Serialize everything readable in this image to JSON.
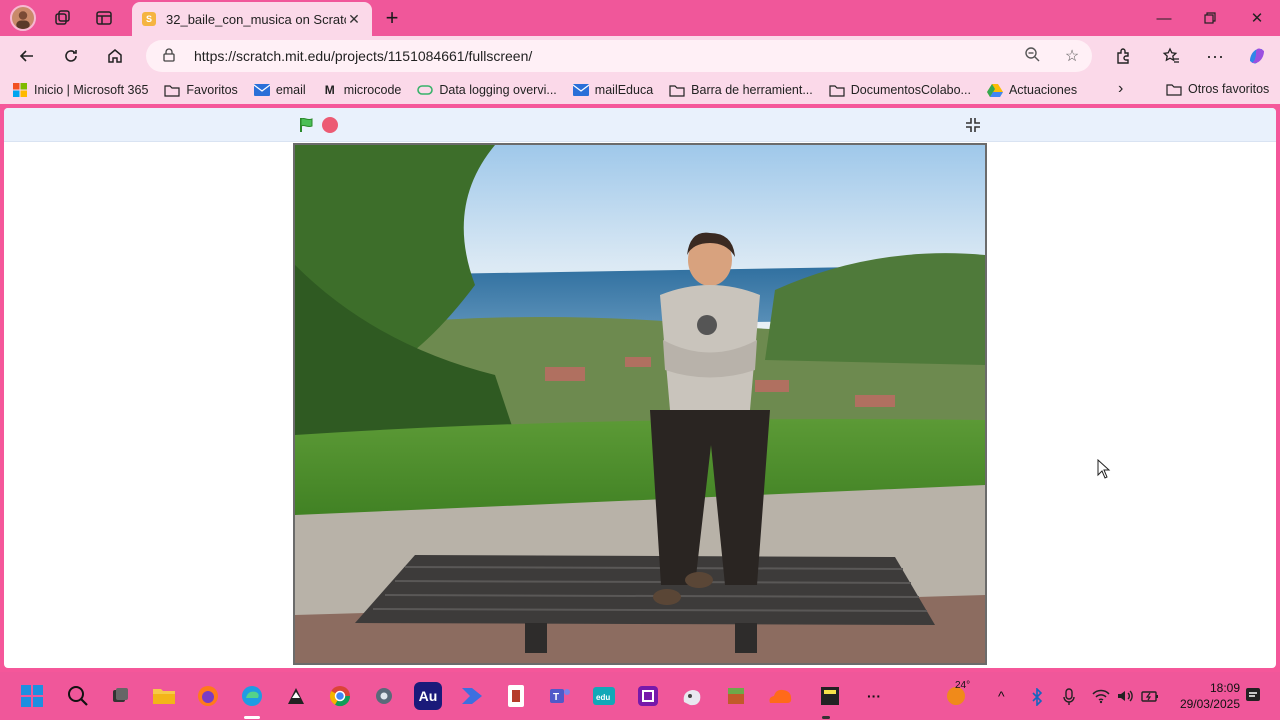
{
  "browser": {
    "tab": {
      "title": "32_baile_con_musica on Scratch",
      "favicon_icon": "scratch-icon"
    },
    "url": "https://scratch.mit.edu/projects/1151084661/fullscreen/",
    "accent_color": "#f0579a"
  },
  "bookmarks": {
    "items": [
      {
        "label": "Inicio | Microsoft 365",
        "icon": "microsoft-icon"
      },
      {
        "label": "Favoritos",
        "icon": "folder-icon"
      },
      {
        "label": "email",
        "icon": "mail-icon"
      },
      {
        "label": "microcode",
        "icon": "microcode-icon"
      },
      {
        "label": "Data logging overvi...",
        "icon": "link-icon"
      },
      {
        "label": "mailEduca",
        "icon": "mail-icon"
      },
      {
        "label": "Barra de herramient...",
        "icon": "folder-icon"
      },
      {
        "label": "DocumentosColabo...",
        "icon": "folder-icon"
      },
      {
        "label": "Actuaciones",
        "icon": "drive-icon"
      }
    ],
    "other_label": "Otros favoritos"
  },
  "scratch": {
    "green_flag_icon": "green-flag-icon",
    "stop_icon": "stop-icon",
    "exit_fullscreen_icon": "exit-fullscreen-icon"
  },
  "taskbar": {
    "weather_temp": "24°",
    "time": "18:09",
    "date": "29/03/2025"
  }
}
